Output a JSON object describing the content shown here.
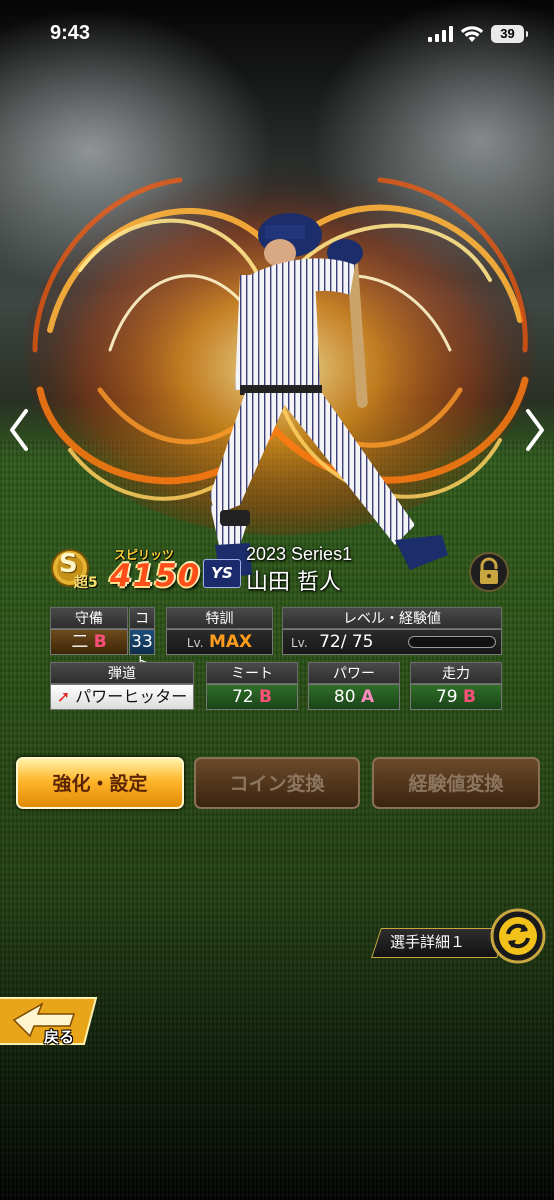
{
  "status_bar": {
    "time": "9:43",
    "battery": "39"
  },
  "card": {
    "rank_letter": "S",
    "rank_sub": "超5",
    "spirits_label": "スピリッツ",
    "spirits_value": "4150",
    "team_abbr": "YS",
    "series": "2023 Series1",
    "player_name": "山田 哲人"
  },
  "stats": {
    "defense": {
      "label": "守備",
      "value": "二",
      "grade": "B"
    },
    "cost": {
      "label": "コスト",
      "value": "33"
    },
    "training": {
      "label": "特訓",
      "lv_prefix": "Lv.",
      "value": "MAX"
    },
    "level": {
      "label": "レベル・経験値",
      "lv_prefix": "Lv.",
      "current": "72",
      "max": "75",
      "exp_fill": 0.0
    },
    "trajectory": {
      "label": "弾道",
      "value": "パワーヒッター"
    },
    "meet": {
      "label": "ミート",
      "value": "72",
      "grade": "B"
    },
    "power": {
      "label": "パワー",
      "value": "80",
      "grade": "A"
    },
    "speed": {
      "label": "走力",
      "value": "79",
      "grade": "B"
    }
  },
  "buttons": {
    "enhance": "強化・設定",
    "coin": "コイン変換",
    "exp": "経験値変換",
    "detail": "選手詳細１",
    "back": "戻る"
  },
  "colors": {
    "accent_orange": "#ffb62b",
    "grade_b": "#ff4f7a",
    "grade_a": "#ff8ac0"
  }
}
